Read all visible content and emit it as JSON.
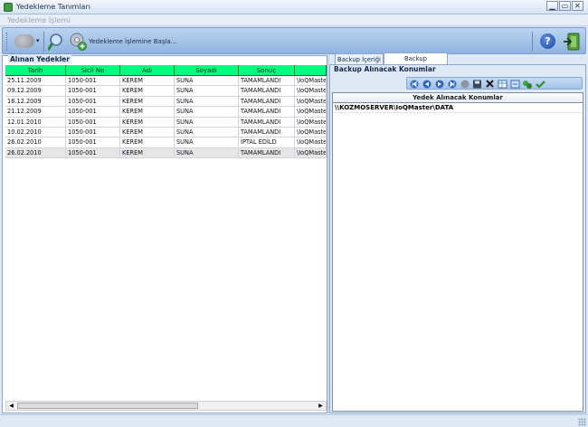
{
  "window": {
    "title": "Yedekleme Tanımları",
    "controls": {
      "minimize": "▁",
      "maximize": "▭",
      "close": "✕"
    }
  },
  "menubar": {
    "items": [
      {
        "label": "Yedekleme İşlemi"
      }
    ]
  },
  "toolbar": {
    "cloud_icon": "cloud-dropdown-icon",
    "dropdown_caret": "▾",
    "search_icon": "magnifier-icon",
    "backup_icon": "backup-add-icon",
    "start_backup_label": "Yedekleme İşlemine Başla...",
    "help_label": "?",
    "exit_icon": "exit-icon"
  },
  "left_panel": {
    "title": "Alınan Yedekler",
    "columns": [
      "Tarih",
      "Sicil No",
      "Adı",
      "Soyadı",
      "Sonuç",
      ""
    ],
    "rows": [
      [
        "25.11.2009",
        "1050-001",
        "KEREM",
        "SUNA",
        "TAMAMLANDI",
        "\\IoQMaster\\"
      ],
      [
        "09.12.2009",
        "1050-001",
        "KEREM",
        "SUNA",
        "TAMAMLANDI",
        "\\IoQMaster\\"
      ],
      [
        "16.12.2009",
        "1050-001",
        "KEREM",
        "SUNA",
        "TAMAMLANDI",
        "\\IoQMaster\\"
      ],
      [
        "21.12.2009",
        "1050-001",
        "KEREM",
        "SUNA",
        "TAMAMLANDI",
        "\\IoQMaster\\"
      ],
      [
        "12.01.2010",
        "1050-001",
        "KEREM",
        "SUNA",
        "TAMAMLANDI",
        "\\IoQMaster\\"
      ],
      [
        "10.02.2010",
        "1050-001",
        "KEREM",
        "SUNA",
        "TAMAMLANDI",
        "\\IoQMaster\\"
      ],
      [
        "26.02.2010",
        "1050-001",
        "KEREM",
        "SUNA",
        "İPTAL EDİLD",
        "\\IoQMaster\\"
      ],
      [
        "26.02.2010",
        "1050-001",
        "KEREM",
        "SUNA",
        "TAMAMLANDI",
        "\\IoQMaster\\"
      ]
    ],
    "scroll": {
      "left": "◀",
      "right": "▶"
    },
    "header_color": "#00ff7f"
  },
  "right_panel": {
    "tabs": [
      {
        "label": "Backup İçeriği"
      },
      {
        "label": "Backup Parametreleri"
      }
    ],
    "active_tab": 1,
    "group_title": "Backup Alınacak Konumlar",
    "mini_toolbar_icons": [
      "first-icon",
      "prev-icon",
      "next-icon",
      "last-icon",
      "stop-icon",
      "save-icon",
      "delete-icon",
      "grid-icon",
      "refresh-icon",
      "copy-icon",
      "check-icon"
    ],
    "table": {
      "header": "Yedek Alınacak Konumlar",
      "rows": [
        "\\\\KOZMOSERVER\\IoQMaster\\DATA"
      ]
    }
  }
}
